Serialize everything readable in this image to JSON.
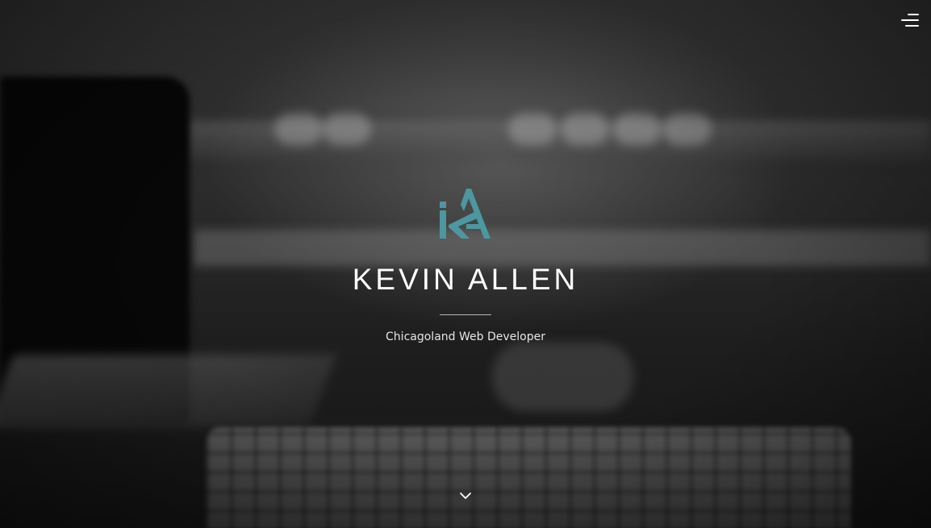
{
  "header": {
    "menu_icon": "hamburger-menu-icon"
  },
  "hero": {
    "logo_icon": "ka-monogram-logo",
    "logo_color": "#4c97a0",
    "name": "KEVIN ALLEN",
    "tagline": "Chicagoland Web Developer",
    "scroll_icon": "chevron-down-icon"
  }
}
